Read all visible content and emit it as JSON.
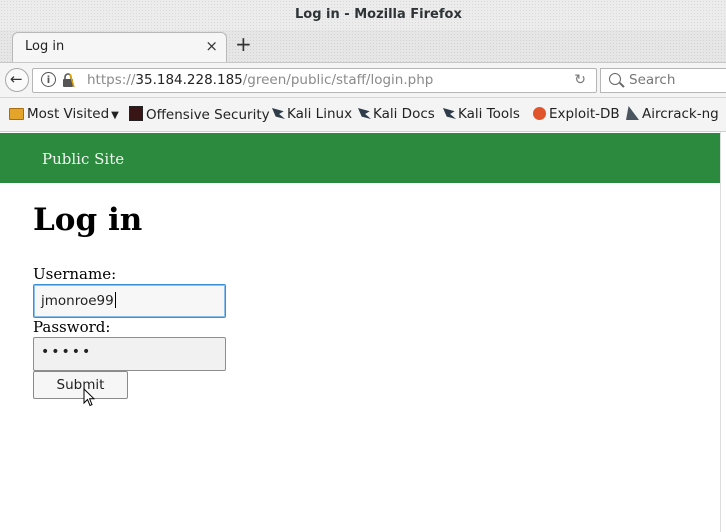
{
  "window": {
    "title": "Log in - Mozilla Firefox"
  },
  "tab": {
    "label": "Log in",
    "close_glyph": "×",
    "new_tab_glyph": "+"
  },
  "nav": {
    "url_prefix": "https://",
    "url_host": "35.184.228.185",
    "url_path": "/green/public/staff/login.php",
    "search_placeholder": "Search"
  },
  "bookmarks": [
    {
      "label": "Most Visited",
      "icon": "folder-icon"
    },
    {
      "label": "Offensive Security",
      "icon": "offensive-security-icon"
    },
    {
      "label": "Kali Linux",
      "icon": "kali-dragon-icon"
    },
    {
      "label": "Kali Docs",
      "icon": "kali-dragon-icon"
    },
    {
      "label": "Kali Tools",
      "icon": "kali-dragon-icon"
    },
    {
      "label": "Exploit-DB",
      "icon": "exploit-db-icon"
    },
    {
      "label": "Aircrack-ng",
      "icon": "aircrack-icon"
    }
  ],
  "site": {
    "header_link": "Public Site",
    "accent": "#2b8a3e",
    "heading": "Log in",
    "username_label": "Username:",
    "username_value": "jmonroe99",
    "password_label": "Password:",
    "password_mask": "•••••",
    "submit_label": "Submit"
  }
}
